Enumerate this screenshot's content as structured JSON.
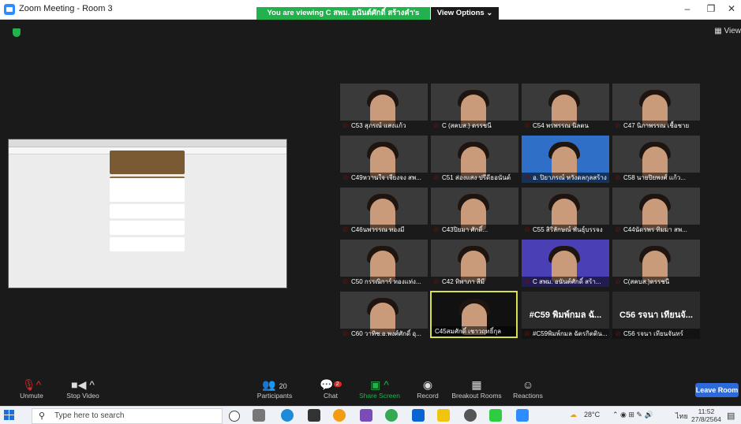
{
  "window": {
    "title": "Zoom Meeting - Room 3",
    "viewing_banner": "You are viewing C สพม. อนันต์ศักดิ์ สร้างคำ's screen",
    "view_options": "View Options ⌄",
    "controls": [
      "–",
      "❐",
      "✕"
    ],
    "view_label": "View"
  },
  "participants": [
    "C53 สุภรณ์ แสงแก้ว",
    "C (สคบส.) ดรรชนี",
    "C54 พรพรรณ นิลตน",
    "C47 นิภาพรรณ เชื้อชาย",
    "C49หวานใจ เจียงจง สพ...",
    "C51 ส่องแสง ปรีดีธอนันต์",
    "อ. ปิยาภรณ์ หวังดลกุลสร้าง",
    "C58 นายปิยพงศ์ แก้ว...",
    "C46นพวรรณ ทองมี",
    "C43ปิยมา ศักดิ์...",
    "C55 สิริลักษณ์ พันธุ์บรรจง",
    "C44นัดรพร ทิมมา สพ...",
    "C50 กรรณิการ์ ทองแท่ง...",
    "C42 ทิพาภา สีมี",
    "C สพม. อนันต์ศักดิ์ สร้า...",
    "C(สคบส.)ดรรชนี",
    "C60 วาทิช.อ.พงศ์ศักดิ์ อุ...",
    "C45สมศักดิ์ เชาวฤทธิ์กุล",
    "#C59พิมพ์กมล ฉัตรกิตติน...",
    "C56 รจนา เทียนจันทร์"
  ],
  "text_tiles": {
    "t18": "#C59 พิมพ์กมล ฉั...",
    "t19": "C56 รจนา เทียนจั..."
  },
  "toolbar": {
    "unmute": "Unmute",
    "stop_video": "Stop Video",
    "participants": "Participants",
    "participants_count": "20",
    "chat": "Chat",
    "chat_badge": "2",
    "share_screen": "Share Screen",
    "record": "Record",
    "breakout": "Breakout Rooms",
    "reactions": "Reactions",
    "leave": "Leave Room"
  },
  "taskbar": {
    "search_placeholder": "Type here to search",
    "temperature": "28°C",
    "lang": "ไทย",
    "time": "11:52",
    "date": "27/8/2564"
  },
  "colors": {
    "viewing_green": "#23b14d",
    "leave_blue": "#2d69d9",
    "mic_red": "#e02828"
  }
}
